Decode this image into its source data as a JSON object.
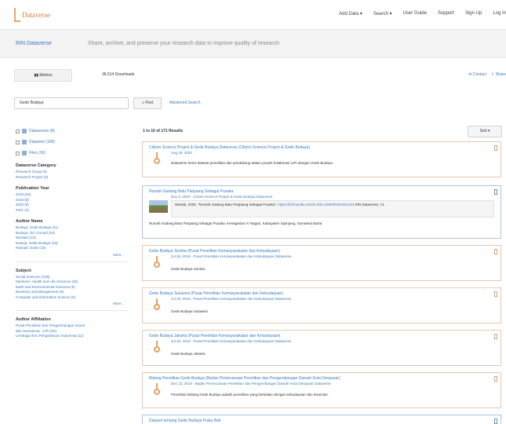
{
  "header": {
    "logo_text": "Dataverse",
    "nav": [
      "Add Data ▾",
      "Search ▾",
      "User Guide",
      "Support",
      "Sign Up",
      "Log In"
    ]
  },
  "dataverse": {
    "name": "RIN Dataverse",
    "tagline": "Share, archive, and preserve your research data to improve quality of research"
  },
  "toolbar": {
    "metrics_label": "Metrics",
    "downloads_label": "36,514 Downloads",
    "contact_label": "Contact",
    "share_label": "Share"
  },
  "search": {
    "value": "Gede Budaya",
    "find_label": "Find",
    "advanced_label": "Advanced Search"
  },
  "sidebar": {
    "types": [
      {
        "label": "Dataverses (8)"
      },
      {
        "label": "Datasets (108)"
      },
      {
        "label": "Files (16)"
      }
    ],
    "facets": [
      {
        "heading": "Dataverse Category",
        "items": [
          "Research Group (5)",
          "Research Project (3)"
        ],
        "more": ""
      },
      {
        "heading": "Publication Year",
        "items": [
          "2019 (30)",
          "2018 (8)",
          "2020 (8)",
          "2021 (3)"
        ],
        "more": ""
      },
      {
        "heading": "Author Name",
        "items": [
          "Budaya, Gede Budaya (11)",
          "Budaya, Gd. Gunadi (10)",
          "Wardani (10)",
          "Sutarja, Gede Budaya (10)",
          "Ratnadi, Gede (10)"
        ],
        "more": "More..."
      },
      {
        "heading": "Subject",
        "items": [
          "Social Sciences (108)",
          "Medicine, Health and Life Sciences (30)",
          "Earth and Environmental Sciences (8)",
          "Business and Management (8)",
          "Computer and Information Science (5)"
        ],
        "more": "More..."
      },
      {
        "heading": "Author Affiliation",
        "items": [
          "Pusat Penelitian dan Pengembangan Sosial",
          "dan Humaniora - LIPI (50)",
          "Lembaga Ilmu Pengetahuan Indonesia (11)"
        ],
        "more": ""
      }
    ]
  },
  "results": {
    "count_label": "1 to 10 of 171 Results",
    "sort_label": "Sort ▾",
    "items": [
      {
        "title": "Citizen Science Project & Gede Budaya Dataverse (Citizen Science Project & Gede Budaya)",
        "sub": "Aug 18, 2020",
        "desc": "Dataverse berisi dataset penelitian dan pendukung dalam proyek kolaborasi LIPI dengan Gede Budaya."
      },
      {
        "title": "Rumah Gadang Batu Panjaang Sebagai Pusaka",
        "sub": "Nov 9, 2020 - Citizen Science Project & Gede Budaya Dataverse",
        "cite_text": "Wanda, 2020, \"Rumah Gadang Batu Panjaang Sebagai Pusaka\", ",
        "cite_link": "https://hdl.handle.net/20.500.12690/RIN/AB1234",
        "cite_tail": " RIN Dataverse, V1",
        "desc": "Rumah Gadang Batu Panjaang Sebagai Pusaka, Kenagarian IV Nagari, Kabupaten Sijunjung, Sumatera Barat"
      },
      {
        "title": "Gede Budaya Sumba (Pusat Penelitian Kemasyarakatan dan Kebudayaan)",
        "sub": "Jul 26, 2019 - Pusat Penelitian Kemasyarakatan dan Kebudayaan Dataverse",
        "desc": "Gede Budaya Sumba"
      },
      {
        "title": "Gede Budaya Sulawesi (Pusat Penelitian Kemasyarakatan dan Kebudayaan)",
        "sub": "Jul 26, 2019 - Pusat Penelitian Kemasyarakatan dan Kebudayaan Dataverse",
        "desc": "Gede Budaya Sulawesi"
      },
      {
        "title": "Gede Budaya Jakarta (Pusat Penelitian Kemasyarakatan dan Kebudayaan)",
        "sub": "Jul 26, 2019 - Pusat Penelitian Kemasyarakatan dan Kebudayaan Dataverse",
        "desc": "Gede Budaya Jakarta"
      },
      {
        "title": "Bidang Penelitian Gede Budaya (Badan Perencanaan Penelitian dan Pengembangan Daerah Kota Denpasar)",
        "sub": "Dec 13, 2019 - Badan Perencanaan Penelitian dan Pengembangan Daerah Kota Denpasar Dataverse",
        "desc": "Penelitian Bidang Gede Budaya adalah penelitian yang berkaitan dengan kebudayaan dan kesenian."
      },
      {
        "title": "Dataset tentang Gede Budaya Pulau Bali",
        "sub": "",
        "desc": ""
      }
    ]
  }
}
